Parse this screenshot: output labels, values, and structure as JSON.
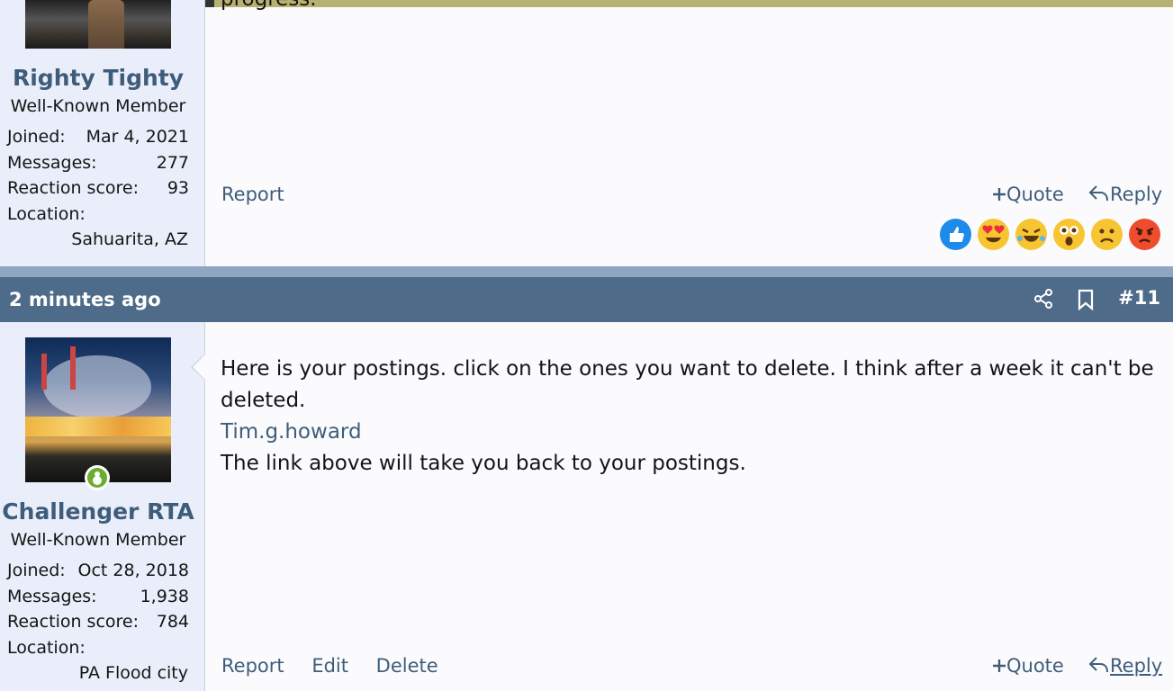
{
  "post1": {
    "author": "Righty Tighty",
    "title": "Well-Known Member",
    "joined_label": "Joined:",
    "joined": "Mar 4, 2021",
    "messages_label": "Messages:",
    "messages": "277",
    "reaction_label": "Reaction score:",
    "reaction_score": "93",
    "location_label": "Location:",
    "location": "Sahuarita, AZ",
    "actions": {
      "report": "Report",
      "quote": "Quote",
      "reply": "Reply"
    },
    "reactions": [
      "like-icon",
      "love-icon",
      "haha-icon",
      "wow-icon",
      "sad-icon",
      "angry-icon"
    ]
  },
  "post2": {
    "time": "2 minutes ago",
    "number": "#11",
    "author": "Challenger RTA",
    "title": "Well-Known Member",
    "joined_label": "Joined:",
    "joined": "Oct 28, 2018",
    "messages_label": "Messages:",
    "messages": "1,938",
    "reaction_label": "Reaction score:",
    "reaction_score": "784",
    "location_label": "Location:",
    "location": "PA Flood city",
    "body_line1": "Here is your postings. click on the ones you want to delete. I think after a week it can't be",
    "body_line2": "deleted.",
    "link": "Tim.g.howard",
    "body_line3": "The link above will take you back to your postings.",
    "actions": {
      "report": "Report",
      "edit": "Edit",
      "delete": "Delete",
      "quote": "Quote",
      "reply": "Reply"
    }
  },
  "colors": {
    "header": "#4e6b89",
    "link": "#3f5d7a",
    "userpane": "#e9eefa",
    "online": "#6aad2d"
  }
}
